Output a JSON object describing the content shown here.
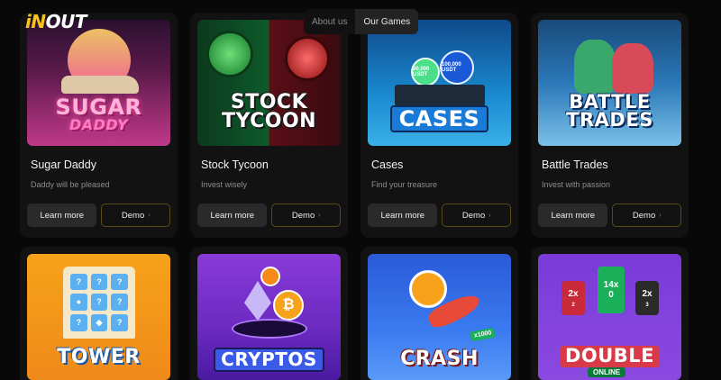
{
  "brand": {
    "logo_in": "iN",
    "logo_out": "OUT"
  },
  "nav": {
    "items": [
      "About us",
      "Our Games"
    ],
    "active": "Our Games"
  },
  "games": [
    {
      "thumb_title": "SUGAR",
      "thumb_sub": "DADDY",
      "title": "Sugar Daddy",
      "subtitle": "Daddy will be pleased",
      "more": "Learn more",
      "demo": "Demo"
    },
    {
      "thumb_title": "STOCK",
      "thumb_sub": "TYCOON",
      "title": "Stock Tycoon",
      "subtitle": "Invest wisely",
      "more": "Learn more",
      "demo": "Demo"
    },
    {
      "thumb_title": "CASES",
      "coin_a": "90,000 USDT",
      "coin_b": "100,000 USDT",
      "title": "Cases",
      "subtitle": "Find your treasure",
      "more": "Learn more",
      "demo": "Demo"
    },
    {
      "thumb_title": "BATTLE",
      "thumb_sub": "TRADES",
      "title": "Battle Trades",
      "subtitle": "Invest with passion",
      "more": "Learn more",
      "demo": "Demo"
    },
    {
      "thumb_title": "TOWER"
    },
    {
      "thumb_title": "CRYPTOS"
    },
    {
      "thumb_title": "CRASH",
      "badge": "x1000"
    },
    {
      "thumb_title": "DOUBLE",
      "thumb_sub": "ONLINE",
      "tiles": [
        {
          "mult": "2x",
          "num": "2"
        },
        {
          "mult": "14x",
          "num": "0"
        },
        {
          "mult": "2x",
          "num": "3"
        }
      ]
    }
  ],
  "colors": {
    "background": "#080808",
    "card": "#121212",
    "accent_logo": "#f7c21a",
    "demo_border": "#5a4a16"
  }
}
